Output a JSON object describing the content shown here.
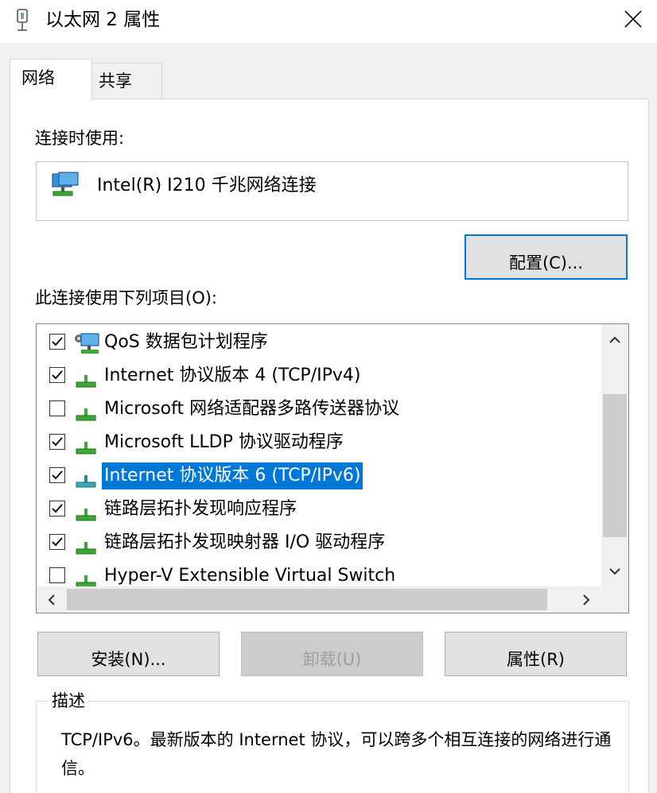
{
  "window": {
    "title": "以太网 2 属性"
  },
  "tabs": [
    {
      "label": "网络",
      "active": true
    },
    {
      "label": "共享",
      "active": false
    }
  ],
  "connect_using": {
    "label": "连接时使用:",
    "adapter": "Intel(R) I210 千兆网络连接",
    "configure_button": "配置(C)..."
  },
  "items": {
    "label": "此连接使用下列项目(O):",
    "list": [
      {
        "label": "QoS 数据包计划程序",
        "checked": true,
        "icon": "network-service-icon",
        "selected": false
      },
      {
        "label": "Internet 协议版本 4 (TCP/IPv4)",
        "checked": true,
        "icon": "network-protocol-icon",
        "selected": false
      },
      {
        "label": "Microsoft 网络适配器多路传送器协议",
        "checked": false,
        "icon": "network-protocol-icon",
        "selected": false
      },
      {
        "label": "Microsoft LLDP 协议驱动程序",
        "checked": true,
        "icon": "network-protocol-icon",
        "selected": false
      },
      {
        "label": "Internet 协议版本 6 (TCP/IPv6)",
        "checked": true,
        "icon": "network-protocol-icon",
        "selected": true
      },
      {
        "label": "链路层拓扑发现响应程序",
        "checked": true,
        "icon": "network-protocol-icon",
        "selected": false
      },
      {
        "label": "链路层拓扑发现映射器 I/O 驱动程序",
        "checked": true,
        "icon": "network-protocol-icon",
        "selected": false
      },
      {
        "label": "Hyper-V Extensible Virtual Switch",
        "checked": false,
        "icon": "network-protocol-icon",
        "selected": false
      }
    ]
  },
  "buttons": {
    "install": "安装(N)...",
    "uninstall": "卸载(U)",
    "properties": "属性(R)"
  },
  "description": {
    "title": "描述",
    "text": "TCP/IPv6。最新版本的 Internet 协议，可以跨多个相互连接的网络进行通信。"
  },
  "colors": {
    "accent": "#0078d7",
    "window_bg": "#f0f0f0",
    "panel_bg": "#ffffff",
    "disabled_text": "#a0a0a0"
  }
}
